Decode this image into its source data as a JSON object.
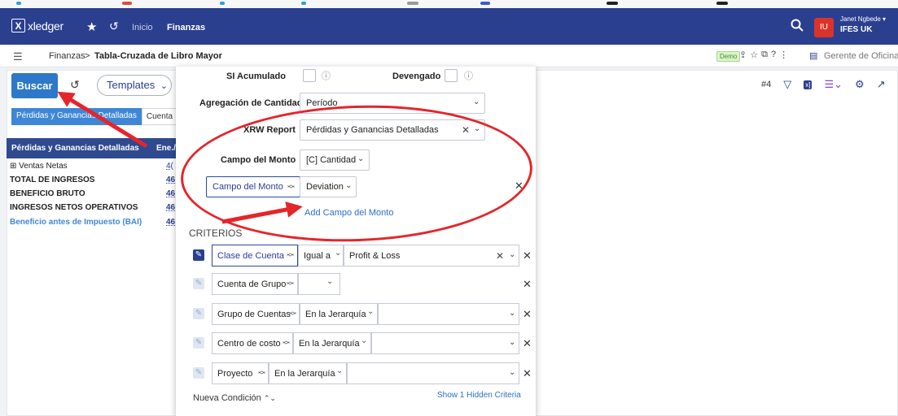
{
  "header": {
    "logo_symbol": "X",
    "logo_text": "xledger",
    "nav_inicio": "Inicio",
    "nav_finanzas": "Finanzas",
    "avatar_initials": "IU",
    "user_name": "Janet Ngbede ▾",
    "user_company": "IFES UK"
  },
  "breadcrumb": {
    "root": "Finanzas",
    "separator": ">",
    "page": "Tabla-Cruzada de Libro Mayor",
    "demo_badge": "Demo",
    "role": "Gerente de Oficina"
  },
  "toolbar": {
    "search_label": "Buscar",
    "templates_label": "Templates",
    "report_number": "#4"
  },
  "tabs": [
    "Pérdidas y Ganancias Detalladas",
    "Cuenta"
  ],
  "report": {
    "header_title": "Pérdidas y Ganancias Detalladas",
    "header_col": "Ene./",
    "rows": [
      {
        "label": "⊞ Ventas Netas",
        "value": "4(",
        "style": "plain"
      },
      {
        "label": "TOTAL DE INGRESOS",
        "value": "46",
        "style": "bold"
      },
      {
        "label": "BENEFICIO BRUTO",
        "value": "46",
        "style": "bold"
      },
      {
        "label": "INGRESOS NETOS OPERATIVOS",
        "value": "46",
        "style": "bold"
      },
      {
        "label": "Beneficio antes de Impuesto (BAI)",
        "value": "46",
        "style": "blue"
      }
    ]
  },
  "settings": {
    "si_acumulado_label": "SI Acumulado",
    "devengado_label": "Devengado",
    "agregacion_label": "Agregación de Cantidad",
    "agregacion_value": "Período",
    "xrw_label": "XRW Report",
    "xrw_value": "Pérdidas y Ganancias Detalladas",
    "campo_monto_label": "Campo del Monto",
    "campo_monto_value": "[C] Cantidad",
    "campo_monto2_label": "Campo del Monto",
    "campo_monto2_value": "Deviation",
    "add_campo_link": "Add Campo del Monto"
  },
  "criteria": {
    "title": "CRITERIOS",
    "rows": [
      {
        "field": "Clase de Cuenta",
        "operator": "Igual a",
        "value": "Profit & Loss",
        "active": true
      },
      {
        "field": "Cuenta de Grupo",
        "operator": "",
        "value": "",
        "active": false
      },
      {
        "field": "Grupo de Cuentas",
        "operator": "En la Jerarquía",
        "value": "",
        "active": false
      },
      {
        "field": "Centro de costo",
        "operator": "En la Jerarquía",
        "value": "",
        "active": false
      },
      {
        "field": "Proyecto",
        "operator": "En la Jerarquía",
        "value": "",
        "active": false
      }
    ],
    "new_condition": "Nueva Condición",
    "show_hidden": "Show 1 Hidden Criteria"
  },
  "colors": {
    "header_bg": "#2b3f8f",
    "accent_blue": "#2d78c8",
    "annotation_red": "#e5252a",
    "avatar_red": "#d9342b"
  },
  "icons": [
    "star-icon",
    "history-icon",
    "search-icon",
    "filter-icon",
    "excel-icon",
    "columns-icon",
    "settings-icon",
    "external-link-icon",
    "info-icon",
    "close-icon",
    "chevron-down-icon",
    "sort-icon",
    "hamburger-icon"
  ]
}
